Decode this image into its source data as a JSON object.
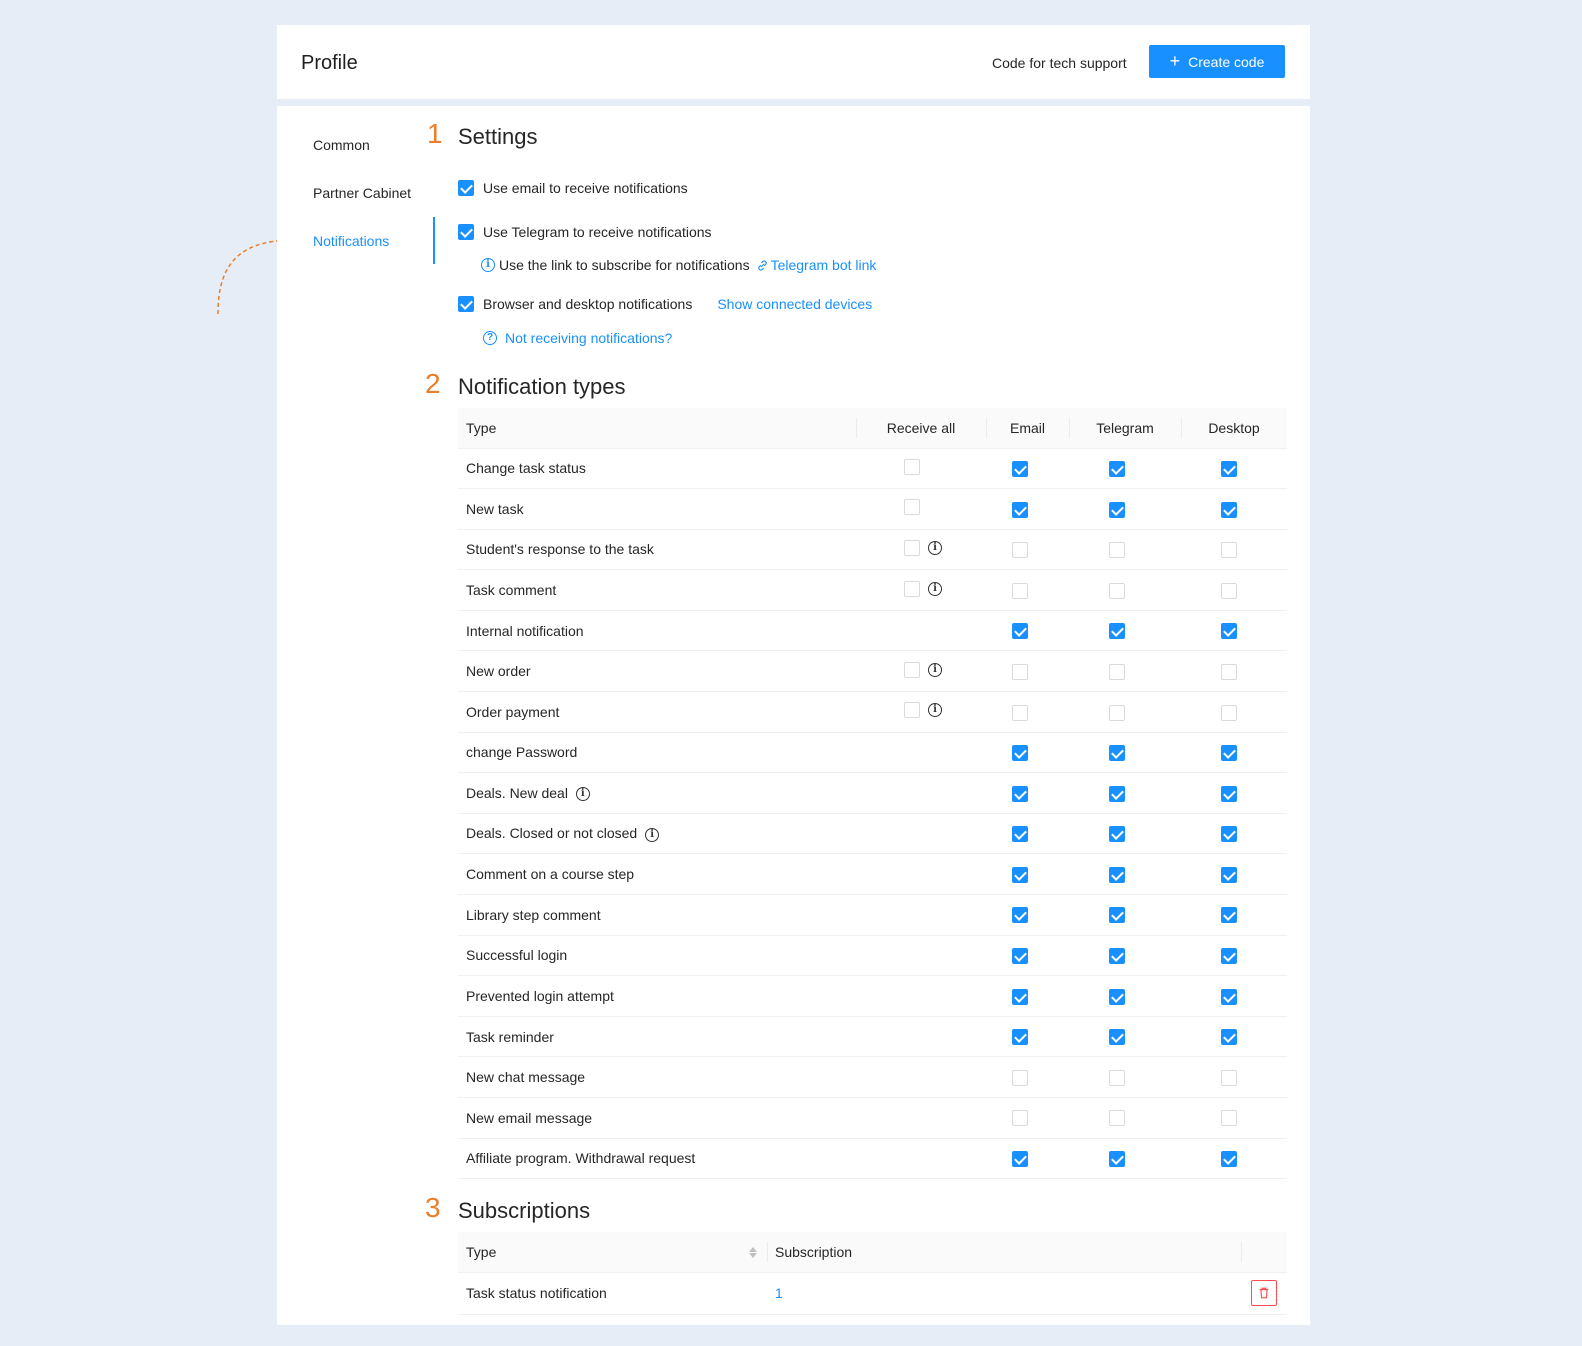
{
  "header": {
    "title": "Profile",
    "tech_support_label": "Code for tech support",
    "create_code_label": "Create code"
  },
  "nav": {
    "items": [
      {
        "label": "Common",
        "active": false
      },
      {
        "label": "Partner Cabinet",
        "active": false
      },
      {
        "label": "Notifications",
        "active": true
      }
    ]
  },
  "settings": {
    "number": "1",
    "title": "Settings",
    "email_label": "Use email to receive notifications",
    "telegram_label": "Use Telegram to receive notifications",
    "telegram_hint": "Use the link to subscribe for notifications",
    "telegram_link": "Telegram bot link",
    "browser_label": "Browser and desktop notifications",
    "show_devices": "Show connected devices",
    "not_receiving": "Not receiving notifications?"
  },
  "notification_types": {
    "number": "2",
    "title": "Notification types",
    "columns": [
      "Type",
      "Receive all",
      "Email",
      "Telegram",
      "Desktop"
    ],
    "rows": [
      {
        "type": "Change task status",
        "receive_all": "unchecked",
        "info": false,
        "email": true,
        "telegram": true,
        "desktop": true
      },
      {
        "type": "New task",
        "receive_all": "unchecked",
        "info": false,
        "email": true,
        "telegram": true,
        "desktop": true
      },
      {
        "type": "Student's response to the task",
        "receive_all": "unchecked",
        "info": true,
        "email": false,
        "telegram": false,
        "desktop": false
      },
      {
        "type": "Task comment",
        "receive_all": "unchecked",
        "info": true,
        "email": false,
        "telegram": false,
        "desktop": false
      },
      {
        "type": "Internal notification",
        "receive_all": "none",
        "info": false,
        "email": true,
        "telegram": true,
        "desktop": true
      },
      {
        "type": "New order",
        "receive_all": "unchecked",
        "info": true,
        "email": false,
        "telegram": false,
        "desktop": false
      },
      {
        "type": "Order payment",
        "receive_all": "unchecked",
        "info": true,
        "email": false,
        "telegram": false,
        "desktop": false
      },
      {
        "type": "change Password",
        "receive_all": "none",
        "info": false,
        "email": true,
        "telegram": true,
        "desktop": true
      },
      {
        "type": "Deals. New deal",
        "type_info": true,
        "receive_all": "none",
        "info": false,
        "email": true,
        "telegram": true,
        "desktop": true
      },
      {
        "type": "Deals. Closed or not closed",
        "type_info": true,
        "receive_all": "none",
        "info": false,
        "email": true,
        "telegram": true,
        "desktop": true
      },
      {
        "type": "Comment on a course step",
        "receive_all": "none",
        "info": false,
        "email": true,
        "telegram": true,
        "desktop": true
      },
      {
        "type": "Library step comment",
        "receive_all": "none",
        "info": false,
        "email": true,
        "telegram": true,
        "desktop": true
      },
      {
        "type": "Successful login",
        "receive_all": "none",
        "info": false,
        "email": true,
        "telegram": true,
        "desktop": true
      },
      {
        "type": "Prevented login attempt",
        "receive_all": "none",
        "info": false,
        "email": true,
        "telegram": true,
        "desktop": true
      },
      {
        "type": "Task reminder",
        "receive_all": "none",
        "info": false,
        "email": true,
        "telegram": true,
        "desktop": true
      },
      {
        "type": "New chat message",
        "receive_all": "none",
        "info": false,
        "email": false,
        "telegram": false,
        "desktop": false
      },
      {
        "type": "New email message",
        "receive_all": "none",
        "info": false,
        "email": false,
        "telegram": false,
        "desktop": false
      },
      {
        "type": "Affiliate program. Withdrawal request",
        "receive_all": "none",
        "info": false,
        "email": true,
        "telegram": true,
        "desktop": true
      }
    ]
  },
  "subscriptions": {
    "number": "3",
    "title": "Subscriptions",
    "columns": [
      "Type",
      "Subscription"
    ],
    "rows": [
      {
        "type": "Task status notification",
        "subscription": "1"
      }
    ]
  },
  "colors": {
    "primary": "#1890ff",
    "accent_orange": "#e97e2b",
    "danger": "#ff4d4f",
    "background": "#e6edf6"
  }
}
